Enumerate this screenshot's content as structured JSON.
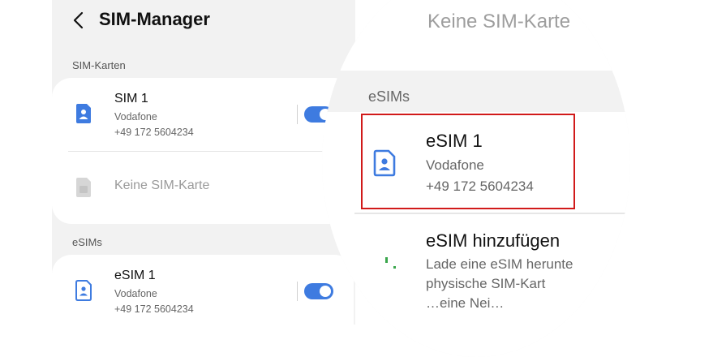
{
  "header": {
    "title": "SIM-Manager"
  },
  "sim_cards": {
    "section_label": "SIM-Karten",
    "items": [
      {
        "name": "SIM 1",
        "carrier": "Vodafone",
        "number": "+49 172 5604234",
        "enabled": true
      },
      {
        "empty_label": "Keine SIM-Karte"
      }
    ]
  },
  "esims": {
    "section_label": "eSIMs",
    "items": [
      {
        "name": "eSIM 1",
        "carrier": "Vodafone",
        "number": "+49 172 5604234",
        "enabled": true
      }
    ]
  },
  "zoom": {
    "top_text": "Keine SIM-Karte",
    "section_label": "eSIMs",
    "esim": {
      "name": "eSIM 1",
      "carrier": "Vodafone",
      "number": "+49 172 5604234"
    },
    "add": {
      "title": "eSIM hinzufügen",
      "desc_line1": "Lade eine eSIM herunte",
      "desc_line2": "physische SIM-Kart",
      "desc_line3": "…eine Nei…"
    }
  },
  "colors": {
    "accent": "#3e7be0",
    "highlight": "#d11a1a",
    "icon_blue": "#3e7be0"
  },
  "icons": {
    "back": "chevron-left-icon",
    "sim": "sim-card-icon",
    "esim": "esim-card-icon",
    "add": "add-esim-icon"
  }
}
